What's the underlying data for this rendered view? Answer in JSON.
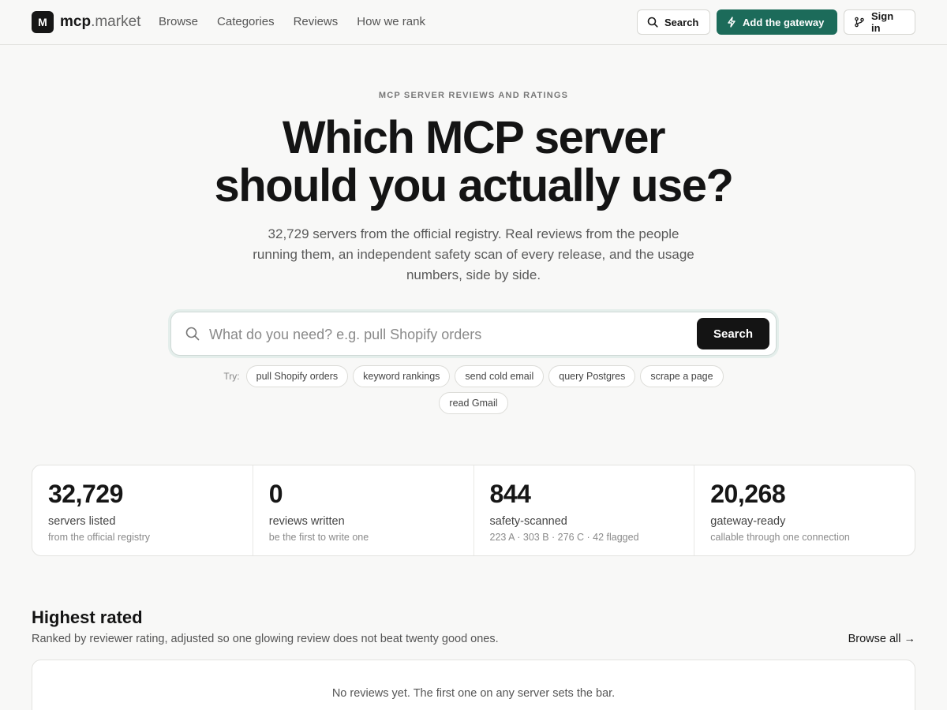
{
  "brand": {
    "logo_letter": "M",
    "name_main": "mcp",
    "name_suffix": ".market"
  },
  "nav": {
    "items": [
      "Browse",
      "Categories",
      "Reviews",
      "How we rank"
    ]
  },
  "header_actions": {
    "search": "Search",
    "gateway": "Add the gateway",
    "signin": "Sign in"
  },
  "hero": {
    "eyebrow": "MCP SERVER REVIEWS AND RATINGS",
    "title_line1": "Which MCP server",
    "title_line2": "should you actually use?",
    "subtitle": "32,729 servers from the official registry. Real reviews from the people running them, an independent safety scan of every release, and the usage numbers, side by side."
  },
  "search": {
    "placeholder": "What do you need? e.g. pull Shopify orders",
    "button": "Search",
    "try_label": "Try:",
    "suggestions": [
      "pull Shopify orders",
      "keyword rankings",
      "send cold email",
      "query Postgres",
      "scrape a page",
      "read Gmail"
    ]
  },
  "stats": [
    {
      "value": "32,729",
      "label": "servers listed",
      "note": "from the official registry"
    },
    {
      "value": "0",
      "label": "reviews written",
      "note": "be the first to write one"
    },
    {
      "value": "844",
      "label": "safety-scanned",
      "note": "223 A · 303 B · 276 C · 42 flagged"
    },
    {
      "value": "20,268",
      "label": "gateway-ready",
      "note": "callable through one connection"
    }
  ],
  "highest_rated": {
    "title": "Highest rated",
    "description": "Ranked by reviewer rating, adjusted so one glowing review does not beat twenty good ones.",
    "browse_all": "Browse all →",
    "empty_message": "No reviews yet. The first one on any server sets the bar."
  },
  "colors": {
    "accent": "#1c6b5a",
    "primary_button": "#141414",
    "background": "#f8f8f7"
  }
}
